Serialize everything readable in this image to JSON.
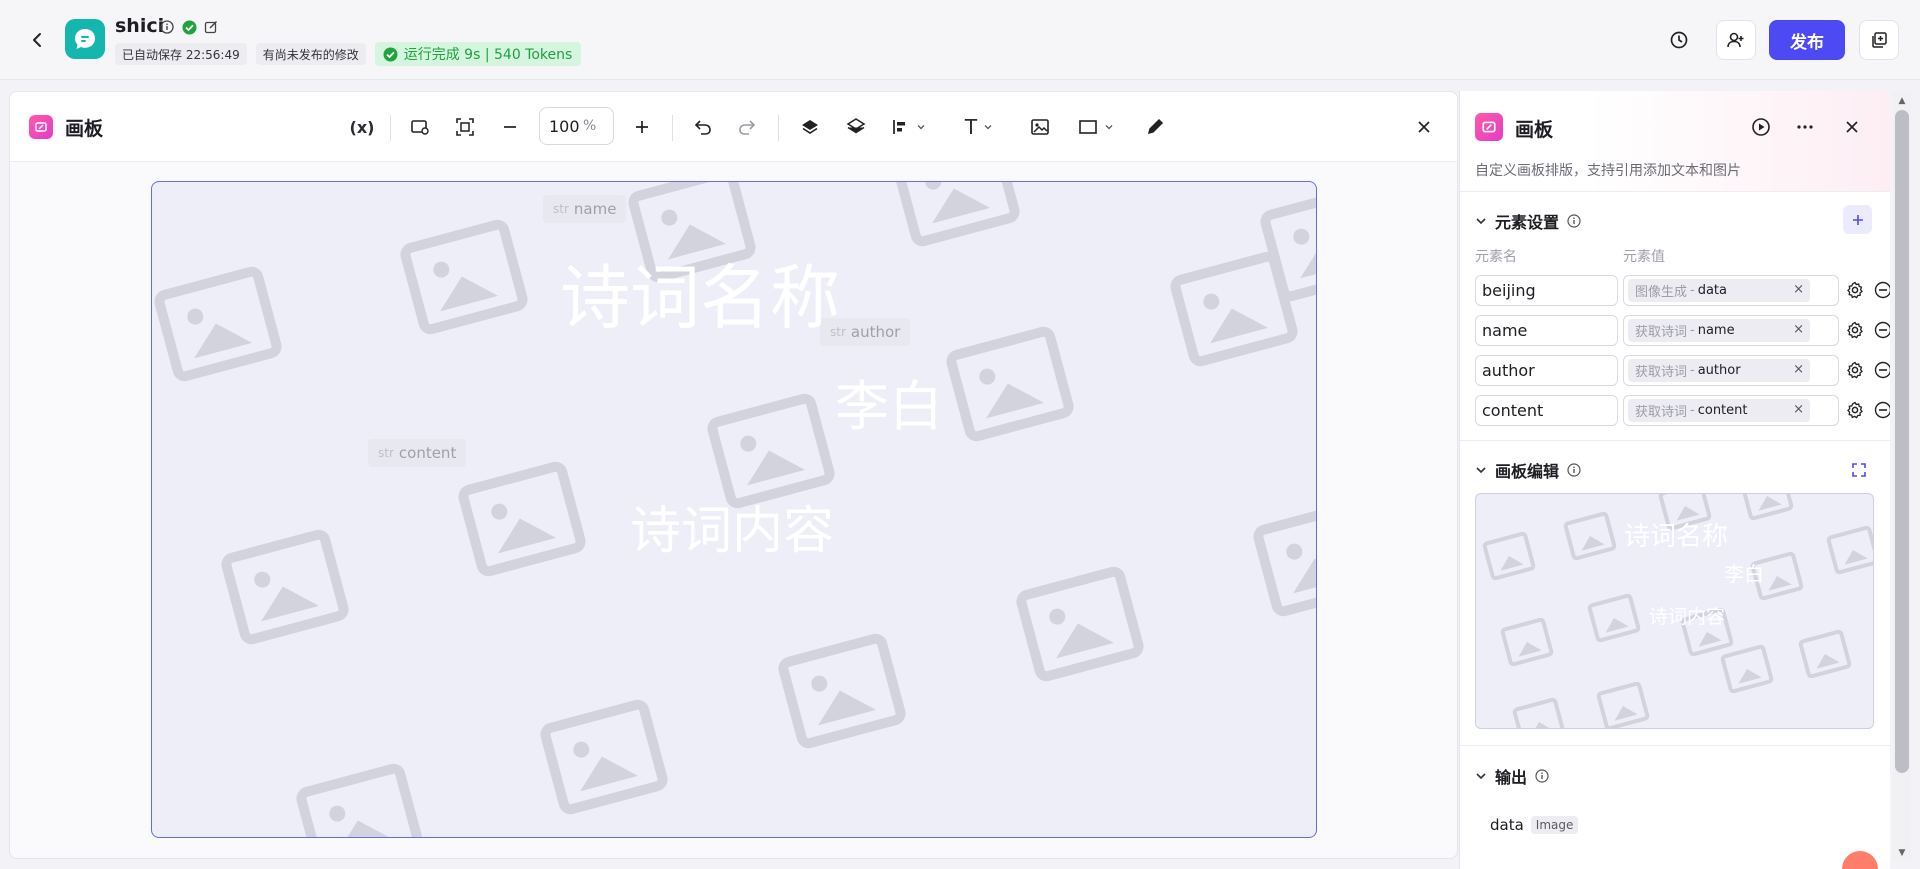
{
  "header": {
    "app_name": "shici",
    "autosave": "已自动保存 22:56:49",
    "unpublished": "有尚未发布的修改",
    "run_status": "运行完成 9s | 540 Tokens",
    "publish_label": "发布",
    "icons": [
      "back-icon",
      "chat-app-icon",
      "info-icon",
      "check-circle-icon",
      "edit-icon",
      "history-icon",
      "collaborators-icon",
      "duplicate-icon"
    ]
  },
  "canvas_panel": {
    "title": "画板",
    "toolbar": {
      "variable_label": "(x)",
      "zoom_value": "100",
      "zoom_unit": "%",
      "text_tool_label": "T"
    },
    "board": {
      "chips": [
        {
          "type": "str",
          "name": "name"
        },
        {
          "type": "str",
          "name": "author"
        },
        {
          "type": "str",
          "name": "content"
        }
      ],
      "texts": {
        "title": "诗词名称",
        "author": "李白",
        "content": "诗词内容"
      }
    }
  },
  "right_panel": {
    "title": "画板",
    "description": "自定义画板排版，支持引用添加文本和图片",
    "element_settings": {
      "title": "元素设置",
      "col_name": "元素名",
      "col_value": "元素值",
      "rows": [
        {
          "name": "beijing",
          "source": "图像生成",
          "field": "data"
        },
        {
          "name": "name",
          "source": "获取诗词",
          "field": "name"
        },
        {
          "name": "author",
          "source": "获取诗词",
          "field": "author"
        },
        {
          "name": "content",
          "source": "获取诗词",
          "field": "content"
        }
      ],
      "separator": "-",
      "clear_symbol": "×"
    },
    "canvas_edit": {
      "title": "画板编辑",
      "preview_texts": {
        "title": "诗词名称",
        "author": "李白",
        "content": "诗词内容"
      }
    },
    "output": {
      "title": "输出",
      "name": "data",
      "type": "Image"
    }
  },
  "colors": {
    "accent": "#4d4af3",
    "success": "#1fa33d",
    "board_border": "#6b68f0",
    "app_icon": "#15b6ae",
    "panel_icon": "#ff5aa8"
  }
}
